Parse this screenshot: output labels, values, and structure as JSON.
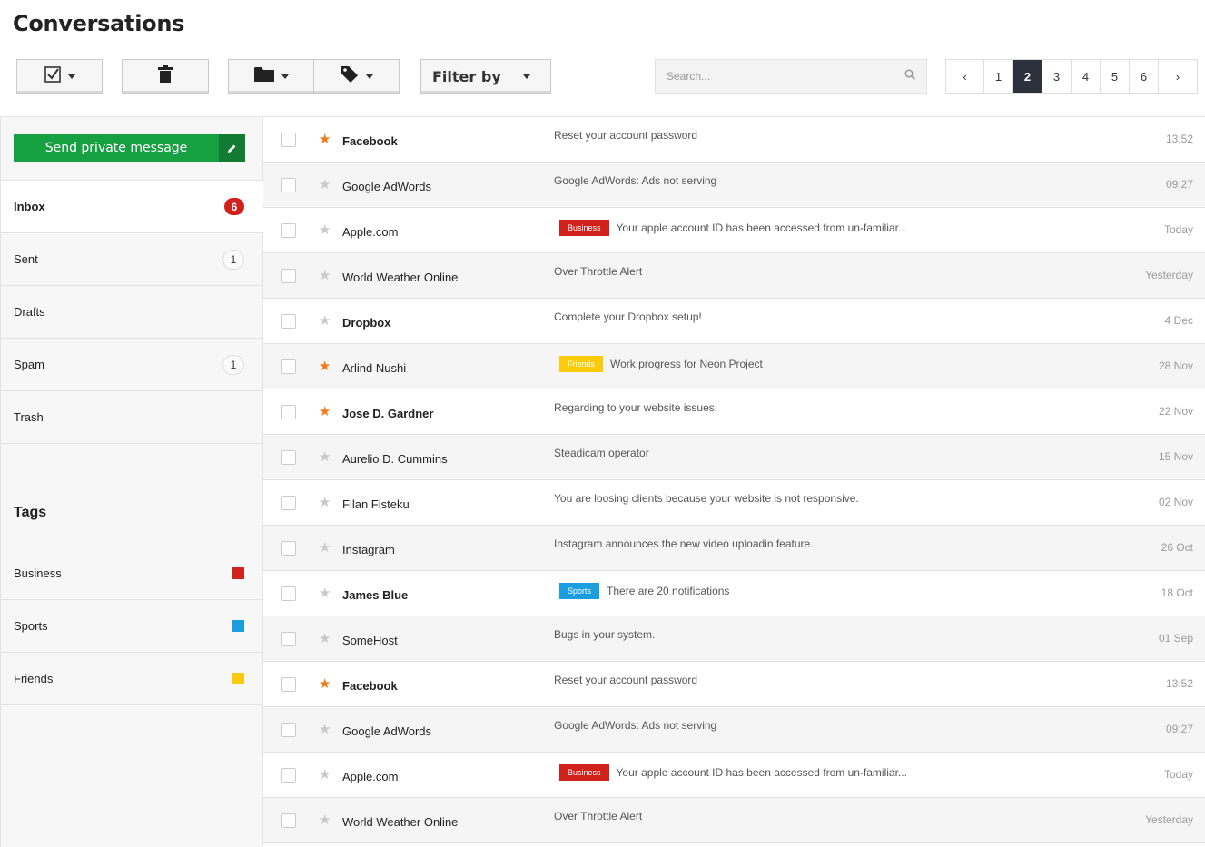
{
  "page": {
    "title": "Conversations"
  },
  "toolbar": {
    "filter_label": "Filter by"
  },
  "search": {
    "placeholder": "Search..."
  },
  "pagination": {
    "prev": "‹",
    "next": "›",
    "pages": [
      "1",
      "2",
      "3",
      "4",
      "5",
      "6"
    ],
    "active": "2"
  },
  "sidebar": {
    "compose_label": "Send private message",
    "folders": [
      {
        "label": "Inbox",
        "count": "6",
        "active": true
      },
      {
        "label": "Sent",
        "count": "1"
      },
      {
        "label": "Drafts",
        "count": ""
      },
      {
        "label": "Spam",
        "count": "1"
      },
      {
        "label": "Trash",
        "count": ""
      }
    ],
    "tags_heading": "Tags",
    "tags": [
      {
        "label": "Business",
        "color": "#d0211b"
      },
      {
        "label": "Sports",
        "color": "#1a9ee0"
      },
      {
        "label": "Friends",
        "color": "#fbcb0b"
      }
    ]
  },
  "tag_colors": {
    "Business": "#d0211b",
    "Sports": "#1a9ee0",
    "Friends": "#fbcb0b"
  },
  "messages": [
    {
      "starred": true,
      "bold": true,
      "sender": "Facebook",
      "tag": "",
      "subject": "Reset your account password",
      "date": "13:52"
    },
    {
      "starred": false,
      "bold": false,
      "sender": "Google AdWords",
      "tag": "",
      "subject": "Google AdWords: Ads not serving",
      "date": "09:27"
    },
    {
      "starred": false,
      "bold": false,
      "sender": "Apple.com",
      "tag": "Business",
      "subject": "Your apple account ID has been accessed from un-familiar...",
      "date": "Today"
    },
    {
      "starred": false,
      "bold": false,
      "sender": "World Weather Online",
      "tag": "",
      "subject": "Over Throttle Alert",
      "date": "Yesterday"
    },
    {
      "starred": false,
      "bold": true,
      "sender": "Dropbox",
      "tag": "",
      "subject": "Complete your Dropbox setup!",
      "date": "4 Dec"
    },
    {
      "starred": true,
      "bold": false,
      "sender": "Arlind Nushi",
      "tag": "Friends",
      "subject": "Work progress for Neon Project",
      "date": "28 Nov"
    },
    {
      "starred": true,
      "bold": true,
      "sender": "Jose D. Gardner",
      "tag": "",
      "subject": "Regarding to your website issues.",
      "date": "22 Nov"
    },
    {
      "starred": false,
      "bold": false,
      "sender": "Aurelio D. Cummins",
      "tag": "",
      "subject": "Steadicam operator",
      "date": "15 Nov"
    },
    {
      "starred": false,
      "bold": false,
      "sender": "Filan Fisteku",
      "tag": "",
      "subject": "You are loosing clients because your website is not responsive.",
      "date": "02 Nov"
    },
    {
      "starred": false,
      "bold": false,
      "sender": "Instagram",
      "tag": "",
      "subject": "Instagram announces the new video uploadin feature.",
      "date": "26 Oct"
    },
    {
      "starred": false,
      "bold": true,
      "sender": "James Blue",
      "tag": "Sports",
      "subject": "There are 20 notifications",
      "date": "18 Oct"
    },
    {
      "starred": false,
      "bold": false,
      "sender": "SomeHost",
      "tag": "",
      "subject": "Bugs in your system.",
      "date": "01 Sep"
    },
    {
      "starred": true,
      "bold": true,
      "sender": "Facebook",
      "tag": "",
      "subject": "Reset your account password",
      "date": "13:52"
    },
    {
      "starred": false,
      "bold": false,
      "sender": "Google AdWords",
      "tag": "",
      "subject": "Google AdWords: Ads not serving",
      "date": "09:27"
    },
    {
      "starred": false,
      "bold": false,
      "sender": "Apple.com",
      "tag": "Business",
      "subject": "Your apple account ID has been accessed from un-familiar...",
      "date": "Today"
    },
    {
      "starred": false,
      "bold": false,
      "sender": "World Weather Online",
      "tag": "",
      "subject": "Over Throttle Alert",
      "date": "Yesterday"
    }
  ]
}
